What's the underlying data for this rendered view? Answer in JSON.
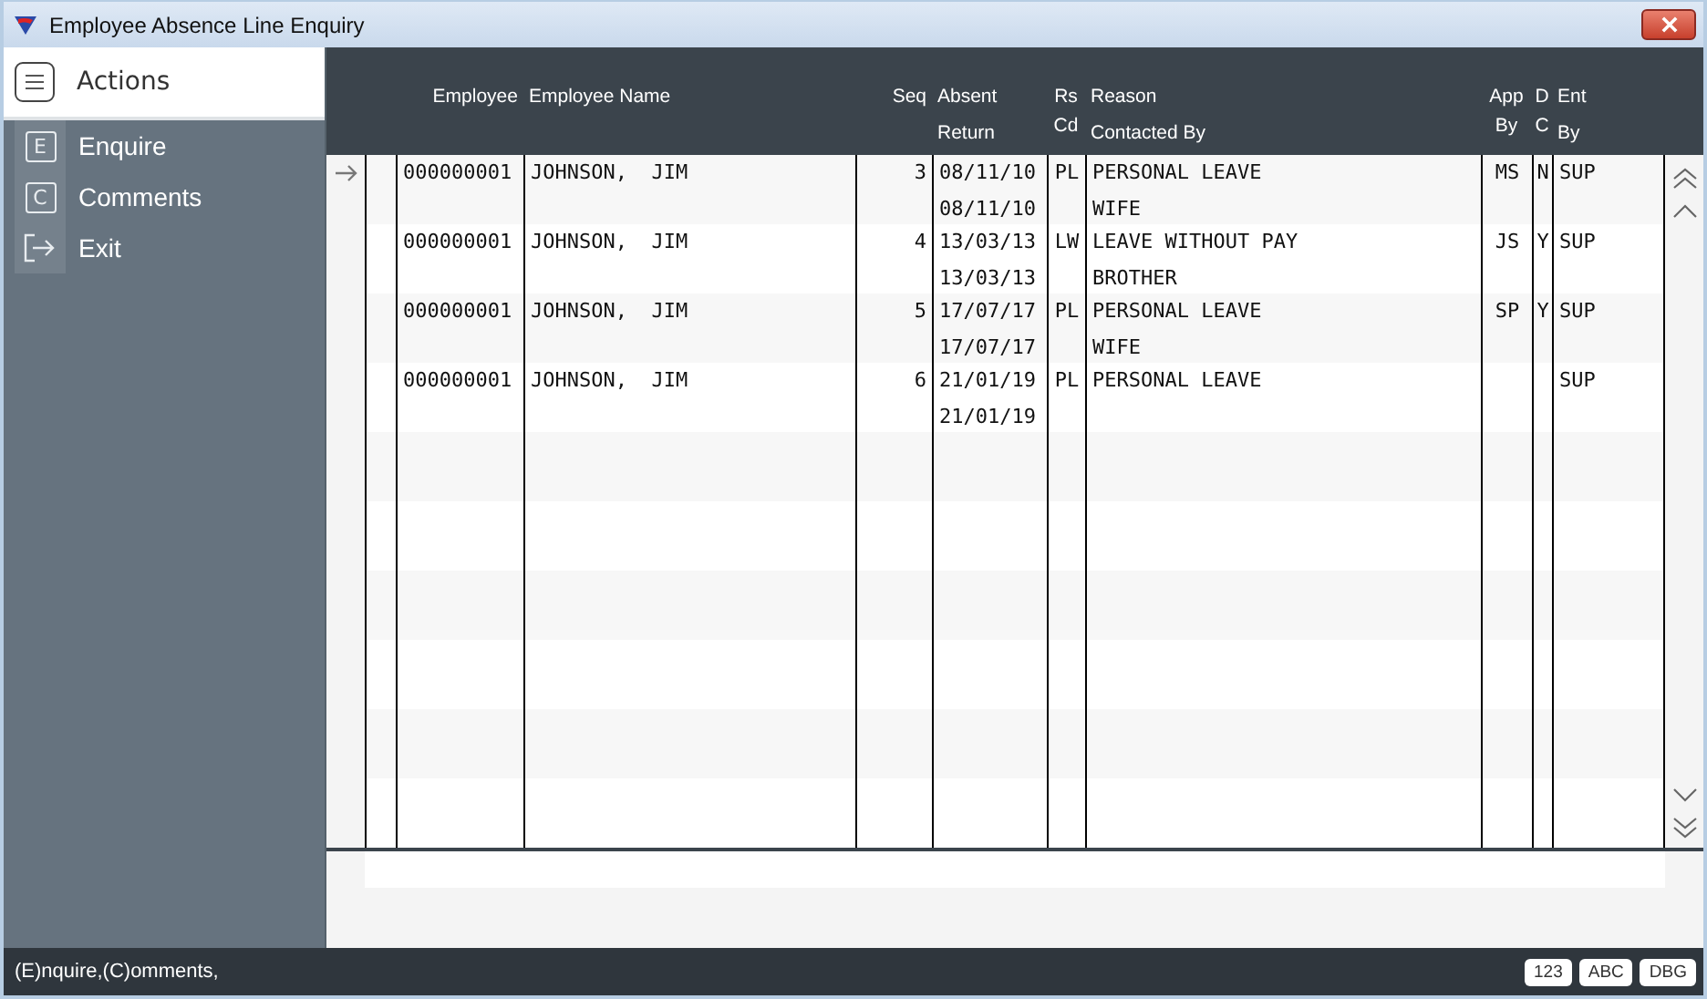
{
  "window": {
    "title": "Employee Absence Line Enquiry"
  },
  "sidebar": {
    "title": "Actions",
    "items": [
      {
        "kind": "key",
        "key": "E",
        "label": "Enquire"
      },
      {
        "kind": "key",
        "key": "C",
        "label": "Comments"
      },
      {
        "kind": "exit",
        "label": "Exit"
      }
    ]
  },
  "table": {
    "columns": [
      {
        "lines": [
          "Employee"
        ]
      },
      {
        "lines": [
          "Employee Name"
        ]
      },
      {
        "lines": [
          "Seq"
        ]
      },
      {
        "lines": [
          "Absent",
          "Return"
        ]
      },
      {
        "lines": [
          "Rs",
          "Cd"
        ]
      },
      {
        "lines": [
          "Reason",
          "Contacted By"
        ]
      },
      {
        "lines": [
          "App",
          "By"
        ]
      },
      {
        "lines": [
          "D",
          "C"
        ]
      },
      {
        "lines": [
          "Ent",
          "By"
        ]
      }
    ],
    "rows": [
      {
        "selected": true,
        "employee": "000000001",
        "name": "JOHNSON,  JIM",
        "seq": "3",
        "absent": "08/11/10",
        "return": "08/11/10",
        "rs_cd": "PL",
        "reason": "PERSONAL LEAVE",
        "contacted_by": "WIFE",
        "app_by": "MS",
        "dc": "N",
        "ent_by": "SUP"
      },
      {
        "selected": false,
        "employee": "000000001",
        "name": "JOHNSON,  JIM",
        "seq": "4",
        "absent": "13/03/13",
        "return": "13/03/13",
        "rs_cd": "LW",
        "reason": "LEAVE WITHOUT PAY",
        "contacted_by": "BROTHER",
        "app_by": "JS",
        "dc": "Y",
        "ent_by": "SUP"
      },
      {
        "selected": false,
        "employee": "000000001",
        "name": "JOHNSON,  JIM",
        "seq": "5",
        "absent": "17/07/17",
        "return": "17/07/17",
        "rs_cd": "PL",
        "reason": "PERSONAL LEAVE",
        "contacted_by": "WIFE",
        "app_by": "SP",
        "dc": "Y",
        "ent_by": "SUP"
      },
      {
        "selected": false,
        "employee": "000000001",
        "name": "JOHNSON,  JIM",
        "seq": "6",
        "absent": "21/01/19",
        "return": "21/01/19",
        "rs_cd": "PL",
        "reason": "PERSONAL LEAVE",
        "ent_by": "SUP"
      }
    ]
  },
  "status_bar": {
    "text": "(E)nquire,(C)omments,",
    "badges": [
      "123",
      "ABC",
      "DBG"
    ]
  }
}
